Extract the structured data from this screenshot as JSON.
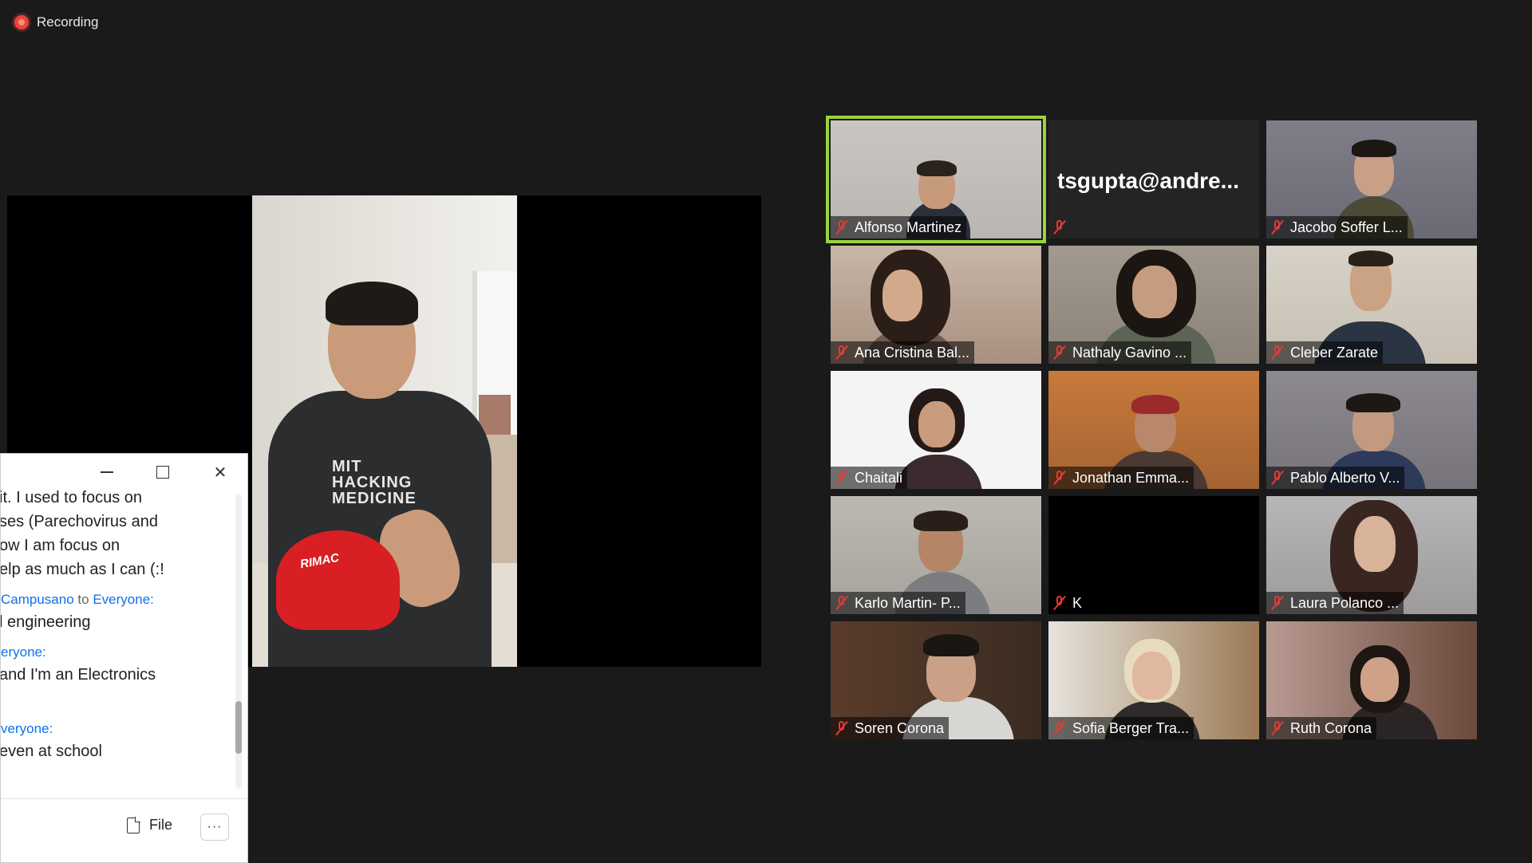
{
  "recording": {
    "label": "Recording"
  },
  "speaker": {
    "shirt_logo": "MIT HACKING MEDICINE",
    "cap_text": "RIMAC"
  },
  "chat": {
    "lines": [
      "it. I used to focus on",
      "ses (Parechovirus and",
      "ow I am focus on",
      "elp as much as I can (:!"
    ],
    "messages": [
      {
        "sender": "Campusano",
        "to_word": "to",
        "recipient": "Everyone:",
        "text": "l engineering"
      },
      {
        "sender": "",
        "to_word": "",
        "recipient": "eryone:",
        "text": "and I'm an Electronics"
      },
      {
        "sender": "",
        "to_word": "",
        "recipient": "veryone:",
        "text": "even at school"
      }
    ],
    "file_label": "File",
    "more_label": "···"
  },
  "gallery": {
    "accent_color": "#9bd33b",
    "participants": [
      {
        "name": "Alfonso Martinez",
        "muted": true,
        "active": true
      },
      {
        "name": "tsgupta@andre...",
        "muted": true,
        "video_off": true
      },
      {
        "name": "Jacobo Soffer L...",
        "muted": true
      },
      {
        "name": "Ana Cristina Bal...",
        "muted": true
      },
      {
        "name": "Nathaly Gavino ...",
        "muted": true
      },
      {
        "name": "Cleber Zarate",
        "muted": true
      },
      {
        "name": "Chaitali",
        "muted": true
      },
      {
        "name": "Jonathan Emma...",
        "muted": true
      },
      {
        "name": "Pablo Alberto V...",
        "muted": true
      },
      {
        "name": "Karlo Martin- P...",
        "muted": true
      },
      {
        "name": "K",
        "muted": true,
        "video_off": true
      },
      {
        "name": "Laura Polanco ...",
        "muted": true
      },
      {
        "name": "Soren Corona",
        "muted": true
      },
      {
        "name": "Sofia Berger Tra...",
        "muted": true
      },
      {
        "name": "Ruth Corona",
        "muted": true
      }
    ]
  }
}
